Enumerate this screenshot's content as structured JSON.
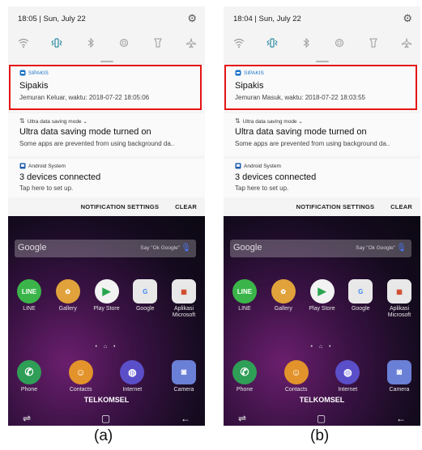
{
  "colors": {
    "highlight": "#e41515",
    "accent": "#1a73c9"
  },
  "phones": [
    {
      "status_text": "18:05 | Sun, July 22",
      "notifications": [
        {
          "app": "SIPAKIS",
          "title": "Sipakis",
          "body": "Jemuran Keluar, waktu: 2018-07-22 18:05:06"
        },
        {
          "app": "Ultra data saving mode ⌄",
          "title": "Ultra data saving mode turned on",
          "body": "Some apps are prevented from using background da.."
        },
        {
          "app": "Android System",
          "title": "3 devices connected",
          "body": "Tap here to set up."
        }
      ],
      "actions": {
        "settings": "NOTIFICATION SETTINGS",
        "clear": "CLEAR"
      },
      "home": {
        "search_logo": "Google",
        "search_hint": "Say \"Ok Google\"",
        "apps_row1": [
          "LINE",
          "Gallery",
          "Play Store",
          "Google",
          "Aplikasi Microsoft"
        ],
        "apps_row2": [
          "Phone",
          "Contacts",
          "Internet",
          "Camera"
        ],
        "carrier": "TELKOMSEL"
      },
      "caption": "(a)"
    },
    {
      "status_text": "18:04 | Sun, July 22",
      "notifications": [
        {
          "app": "SIPAKIS",
          "title": "Sipakis",
          "body": "Jemuran Masuk, waktu: 2018-07-22 18:03:55"
        },
        {
          "app": "Ultra data saving mode ⌄",
          "title": "Ultra data saving mode turned on",
          "body": "Some apps are prevented from using background da.."
        },
        {
          "app": "Android System",
          "title": "3 devices connected",
          "body": "Tap here to set up."
        }
      ],
      "actions": {
        "settings": "NOTIFICATION SETTINGS",
        "clear": "CLEAR"
      },
      "home": {
        "search_logo": "Google",
        "search_hint": "Say \"Ok Google\"",
        "apps_row1": [
          "LINE",
          "Gallery",
          "Play Store",
          "Google",
          "Aplikasi Microsoft"
        ],
        "apps_row2": [
          "Phone",
          "Contacts",
          "Internet",
          "Camera"
        ],
        "carrier": "TELKOMSEL"
      },
      "caption": "(b)"
    }
  ]
}
